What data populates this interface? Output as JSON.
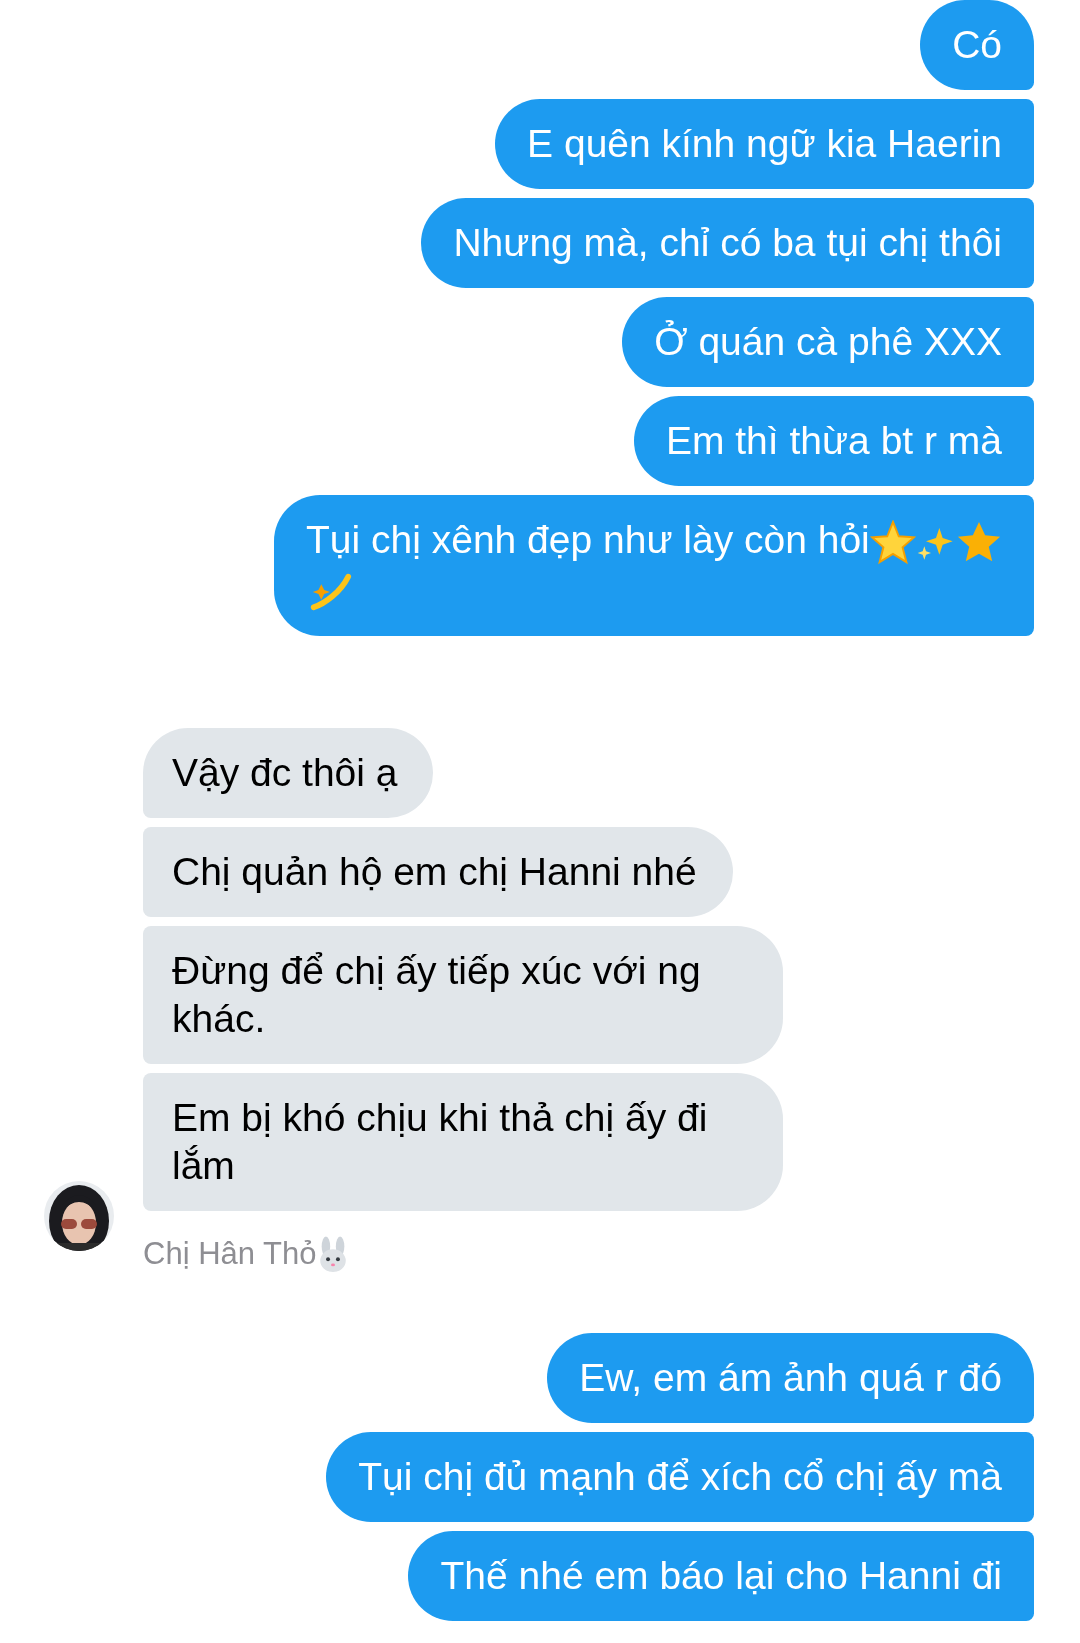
{
  "groups": [
    {
      "kind": "outgoing",
      "messages": [
        {
          "text": "Có"
        },
        {
          "text": "E quên kính ngữ kia Haerin"
        },
        {
          "text": "Nhưng mà, chỉ có ba tụi chị thôi"
        },
        {
          "text": "Ở quán cà phê XXX"
        },
        {
          "text": "Em thì thừa bt r mà"
        },
        {
          "text": "Tụi chị xênh đẹp như lày còn hỏi",
          "trailing_icons": [
            {
              "kind": "glowing-star"
            },
            {
              "kind": "sparkles"
            },
            {
              "kind": "star"
            },
            {
              "kind": "dizzy"
            }
          ]
        }
      ]
    },
    {
      "kind": "incoming",
      "sender": "Chị Hân Thỏ",
      "sender_icon": {
        "kind": "bunny"
      },
      "messages": [
        {
          "text": "Vậy đc thôi ạ"
        },
        {
          "text": "Chị quản hộ em chị Hanni nhé"
        },
        {
          "text": "Đừng để chị ấy tiếp xúc với ng khác."
        },
        {
          "text": "Em bị khó chịu khi thả chị ấy đi lắm"
        }
      ]
    },
    {
      "kind": "outgoing",
      "messages": [
        {
          "text": "Ew, em ám ảnh quá r đó"
        },
        {
          "text": "Tụi chị đủ mạnh để xích cổ chị ấy mà"
        },
        {
          "text": "Thế nhé em báo lại cho Hanni đi"
        }
      ]
    }
  ]
}
